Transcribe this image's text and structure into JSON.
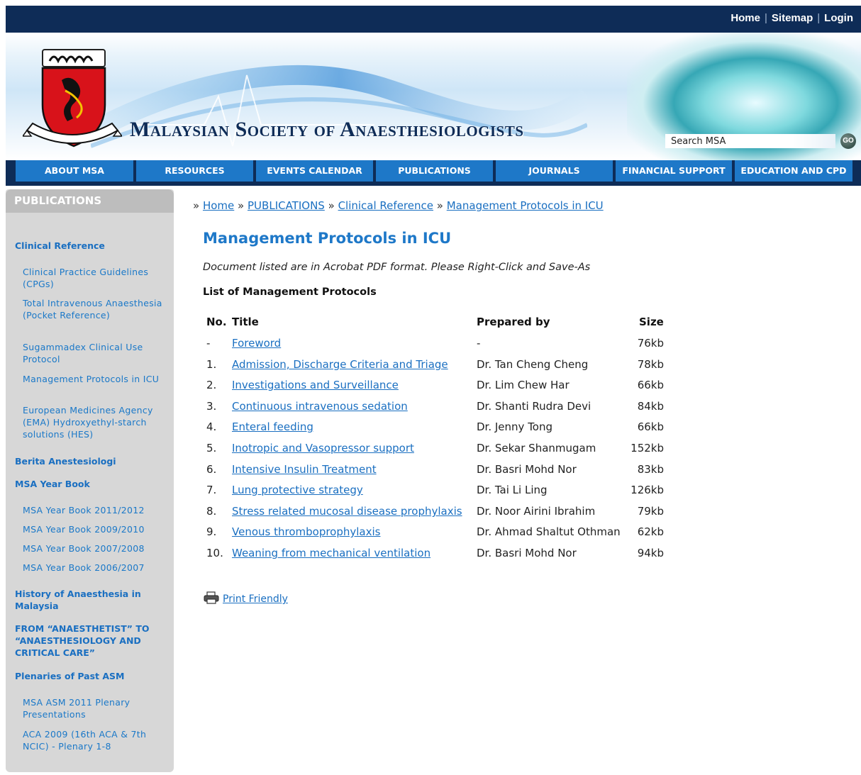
{
  "toplinks": {
    "home": "Home",
    "sitemap": "Sitemap",
    "login": "Login",
    "separator": "|"
  },
  "banner": {
    "site_title": "Malaysian Society of Anaesthesiologists",
    "search_value": "Search MSA",
    "search_go": "GO"
  },
  "nav": {
    "items": [
      "ABOUT MSA",
      "RESOURCES",
      "EVENTS CALENDAR",
      "PUBLICATIONS",
      "JOURNALS",
      "FINANCIAL SUPPORT",
      "EDUCATION AND CPD"
    ]
  },
  "sidebar": {
    "heading": "PUBLICATIONS",
    "clinical_reference": "Clinical Reference",
    "clinical_items": [
      "Clinical Practice Guidelines (CPGs)",
      "Total Intravenous Anaesthesia (Pocket Reference)",
      "Sugammadex Clinical Use Protocol",
      "Management Protocols in ICU",
      "European Medicines Agency (EMA) Hydroxyethyl-starch solutions (HES)"
    ],
    "berita": "Berita Anestesiologi",
    "yearbook": "MSA Year Book",
    "yearbook_items": [
      "MSA Year Book 2011/2012",
      "MSA Year Book 2009/2010",
      "MSA Year Book 2007/2008",
      "MSA Year Book 2006/2007"
    ],
    "history": "History of Anaesthesia in Malaysia",
    "from_anaesthetist": "FROM “ANAESTHETIST” TO “ANAESTHESIOLOGY AND CRITICAL CARE”",
    "plenaries": "Plenaries of Past ASM",
    "plenary_items": [
      "MSA ASM 2011 Plenary Presentations",
      "ACA 2009 (16th ACA & 7th NCIC) - Plenary 1-8"
    ]
  },
  "breadcrumb": {
    "sep": "»",
    "items": [
      "Home",
      "PUBLICATIONS",
      "Clinical Reference",
      "Management Protocols in ICU"
    ]
  },
  "main": {
    "title": "Management Protocols in ICU",
    "intro": "Document listed are in Acrobat PDF format. Please Right-Click and Save-As",
    "subheading": "List of Management Protocols",
    "columns": {
      "no": "No.",
      "title": "Title",
      "prepared": "Prepared by",
      "size": "Size"
    },
    "rows": [
      {
        "no": "-",
        "title": "Foreword",
        "prepared": "-",
        "size": "76kb"
      },
      {
        "no": "1.",
        "title": "Admission, Discharge Criteria and Triage",
        "prepared": "Dr. Tan Cheng Cheng",
        "size": "78kb"
      },
      {
        "no": "2.",
        "title": "Investigations and Surveillance",
        "prepared": "Dr. Lim Chew Har",
        "size": "66kb"
      },
      {
        "no": "3.",
        "title": "Continuous intravenous sedation",
        "prepared": "Dr. Shanti Rudra Devi",
        "size": "84kb"
      },
      {
        "no": "4.",
        "title": "Enteral feeding",
        "prepared": "Dr. Jenny Tong",
        "size": "66kb"
      },
      {
        "no": "5.",
        "title": "Inotropic and Vasopressor support",
        "prepared": "Dr. Sekar Shanmugam",
        "size": "152kb"
      },
      {
        "no": "6.",
        "title": "Intensive Insulin Treatment",
        "prepared": "Dr. Basri Mohd Nor",
        "size": "83kb"
      },
      {
        "no": "7.",
        "title": "Lung protective strategy",
        "prepared": "Dr. Tai Li Ling",
        "size": "126kb"
      },
      {
        "no": "8.",
        "title": "Stress related mucosal disease prophylaxis",
        "prepared": "Dr. Noor Airini Ibrahim",
        "size": "79kb"
      },
      {
        "no": "9.",
        "title": "Venous thromboprophylaxis",
        "prepared": "Dr. Ahmad Shaltut Othman",
        "size": "62kb"
      },
      {
        "no": "10.",
        "title": "Weaning from mechanical ventilation",
        "prepared": "Dr. Basri Mohd Nor",
        "size": "94kb"
      }
    ],
    "print_label": "Print Friendly"
  },
  "colors": {
    "navy": "#0e2c57",
    "nav_blue": "#1e78c8",
    "link": "#1a6fc1",
    "sidebar_bg": "#d7d7d7"
  }
}
